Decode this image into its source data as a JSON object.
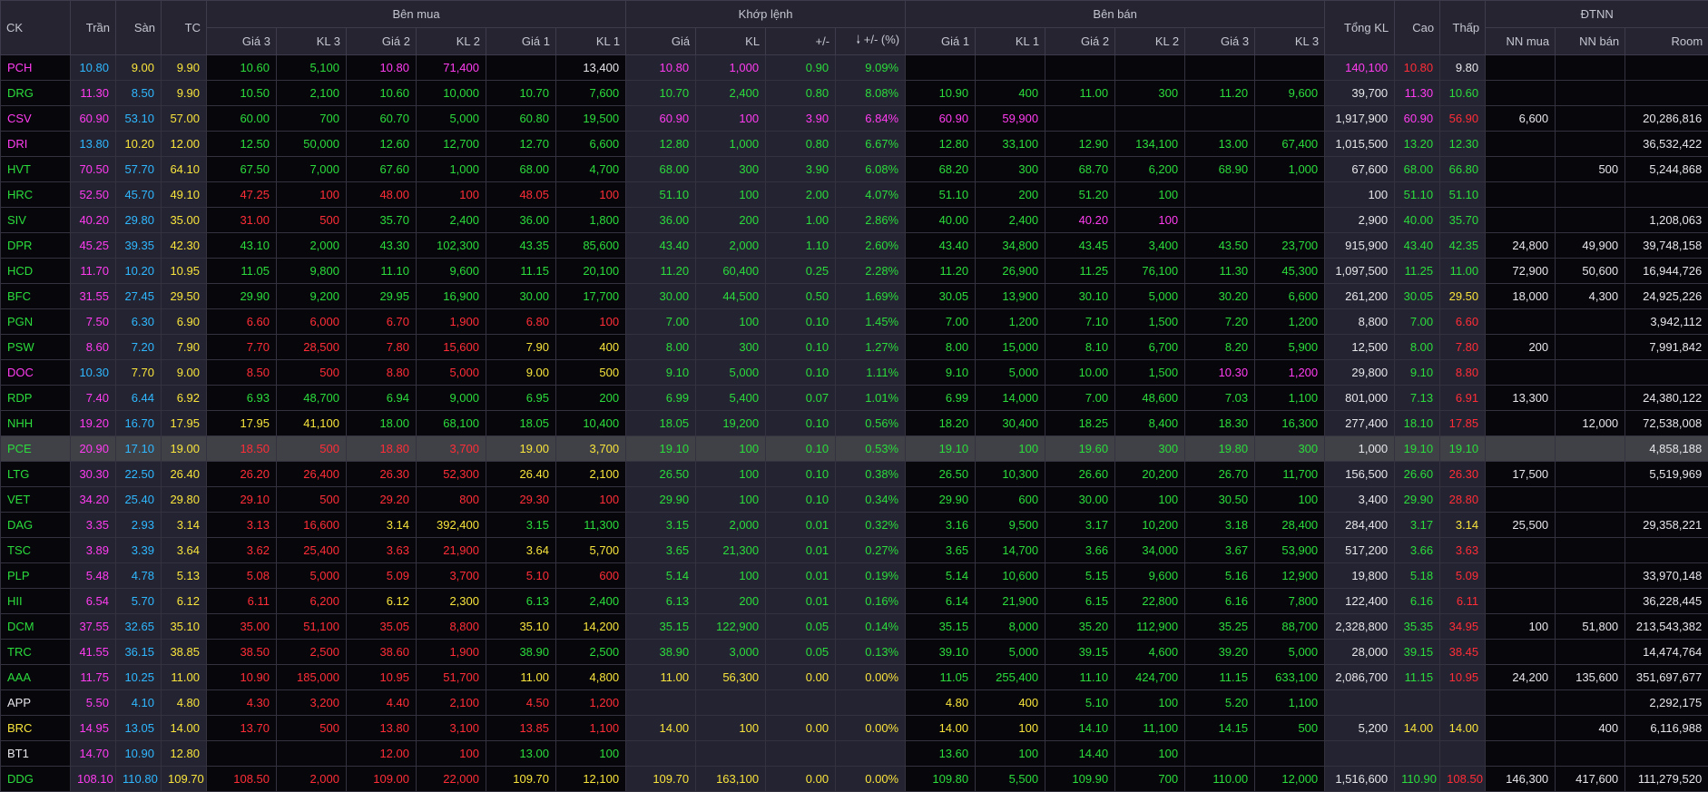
{
  "colors": {
    "up": "#2bdc3c",
    "down": "#ff2d37",
    "ref": "#f8e43c",
    "ceil": "#ff3cf0",
    "floor": "#2fb8ff",
    "white": "#e6e6ea"
  },
  "header": {
    "ck": "CK",
    "tran": "Trần",
    "san": "Sàn",
    "tc": "TC",
    "ben_mua": "Bên mua",
    "khop_lenh": "Khớp lệnh",
    "ben_ban": "Bên bán",
    "tong_kl": "Tổng KL",
    "cao": "Cao",
    "thap": "Thấp",
    "dtnn": "ĐTNN",
    "buy_cols": [
      "Giá 3",
      "KL 3",
      "Giá 2",
      "KL 2",
      "Giá 1",
      "KL 1"
    ],
    "match_cols": [
      "Giá",
      "KL",
      "+/-",
      "+/- (%)"
    ],
    "sell_cols": [
      "Giá 1",
      "KL 1",
      "Giá 2",
      "KL 2",
      "Giá 3",
      "KL 3"
    ],
    "dtnn_cols": [
      "NN mua",
      "NN bán",
      "Room"
    ],
    "sort_icon": "arrow-down-icon"
  },
  "rows": [
    {
      "c": [
        "PCH",
        "10.80",
        "9.00",
        "9.90",
        "10.60",
        "5,100",
        "10.80",
        "71,400",
        "",
        "13,400",
        "10.80",
        "1,000",
        "0.90",
        "9.09%",
        "",
        "",
        "",
        "",
        "",
        "",
        "140,100",
        "10.80",
        "9.80",
        "",
        "",
        ""
      ],
      "k": "cfrr uu cc _w cc uu uu xx uu cd xxx"
    },
    {
      "c": [
        "DRG",
        "11.30",
        "8.50",
        "9.90",
        "10.50",
        "2,100",
        "10.60",
        "10,000",
        "10.70",
        "7,600",
        "10.70",
        "2,400",
        "0.80",
        "8.08%",
        "10.90",
        "400",
        "11.00",
        "300",
        "11.20",
        "9,600",
        "39,700",
        "11.30",
        "10.60",
        "",
        "",
        ""
      ],
      "k": "ucfr uuuuuu uuuu uuuuuu w cu xxx"
    },
    {
      "c": [
        "CSV",
        "60.90",
        "53.10",
        "57.00",
        "60.00",
        "700",
        "60.70",
        "5,000",
        "60.80",
        "19,500",
        "60.90",
        "100",
        "3.90",
        "6.84%",
        "60.90",
        "59,900",
        "",
        "",
        "",
        "",
        "1,917,900",
        "60.90",
        "56.90",
        "6,600",
        "",
        "20,286,816"
      ],
      "k": "ccfr uuuuuu cccc cc____ w cd wxw"
    },
    {
      "c": [
        "DRI",
        "13.80",
        "10.20",
        "12.00",
        "12.50",
        "50,000",
        "12.60",
        "12,700",
        "12.70",
        "6,600",
        "12.80",
        "1,000",
        "0.80",
        "6.67%",
        "12.80",
        "33,100",
        "12.90",
        "134,100",
        "13.00",
        "67,400",
        "1,015,500",
        "13.20",
        "12.30",
        "",
        "",
        "36,532,422"
      ],
      "k": "cfrr uuuuuu uuuu uuuuuu w uu xxw"
    },
    {
      "c": [
        "HVT",
        "70.50",
        "57.70",
        "64.10",
        "67.50",
        "7,000",
        "67.60",
        "1,000",
        "68.00",
        "4,700",
        "68.00",
        "300",
        "3.90",
        "6.08%",
        "68.20",
        "300",
        "68.70",
        "6,200",
        "68.90",
        "1,000",
        "67,600",
        "68.00",
        "66.80",
        "",
        "500",
        "5,244,868"
      ],
      "k": "ucfr uuuuuu uuuu uuuuuu w uu xww"
    },
    {
      "c": [
        "HRC",
        "52.50",
        "45.70",
        "49.10",
        "47.25",
        "100",
        "48.00",
        "100",
        "48.05",
        "100",
        "51.10",
        "100",
        "2.00",
        "4.07%",
        "51.10",
        "200",
        "51.20",
        "100",
        "",
        "",
        "100",
        "51.10",
        "51.10",
        "",
        "",
        ""
      ],
      "k": "ucfr dddddd uuuu uuuu__ w uu xxx"
    },
    {
      "c": [
        "SIV",
        "40.20",
        "29.80",
        "35.00",
        "31.00",
        "500",
        "35.70",
        "2,400",
        "36.00",
        "1,800",
        "36.00",
        "200",
        "1.00",
        "2.86%",
        "40.00",
        "2,400",
        "40.20",
        "100",
        "",
        "",
        "2,900",
        "40.00",
        "35.70",
        "",
        "",
        "1,208,063"
      ],
      "k": "ucfr dduuuu uuuu uucc__ w uu xxw"
    },
    {
      "c": [
        "DPR",
        "45.25",
        "39.35",
        "42.30",
        "43.10",
        "2,000",
        "43.30",
        "102,300",
        "43.35",
        "85,600",
        "43.40",
        "2,000",
        "1.10",
        "2.60%",
        "43.40",
        "34,800",
        "43.45",
        "3,400",
        "43.50",
        "23,700",
        "915,900",
        "43.40",
        "42.35",
        "24,800",
        "49,900",
        "39,748,158"
      ],
      "k": "ucfr uuuuuu uuuu uuuuuu w uu www"
    },
    {
      "c": [
        "HCD",
        "11.70",
        "10.20",
        "10.95",
        "11.05",
        "9,800",
        "11.10",
        "9,600",
        "11.15",
        "20,100",
        "11.20",
        "60,400",
        "0.25",
        "2.28%",
        "11.20",
        "26,900",
        "11.25",
        "76,100",
        "11.30",
        "45,300",
        "1,097,500",
        "11.25",
        "11.00",
        "72,900",
        "50,600",
        "16,944,726"
      ],
      "k": "ucfr uuuuuu uuuu uuuuuu w uu www"
    },
    {
      "c": [
        "BFC",
        "31.55",
        "27.45",
        "29.50",
        "29.90",
        "9,200",
        "29.95",
        "16,900",
        "30.00",
        "17,700",
        "30.00",
        "44,500",
        "0.50",
        "1.69%",
        "30.05",
        "13,900",
        "30.10",
        "5,000",
        "30.20",
        "6,600",
        "261,200",
        "30.05",
        "29.50",
        "18,000",
        "4,300",
        "24,925,226"
      ],
      "k": "ucfr uuuuuu uuuu uuuuuu w ur www"
    },
    {
      "c": [
        "PGN",
        "7.50",
        "6.30",
        "6.90",
        "6.60",
        "6,000",
        "6.70",
        "1,900",
        "6.80",
        "100",
        "7.00",
        "100",
        "0.10",
        "1.45%",
        "7.00",
        "1,200",
        "7.10",
        "1,500",
        "7.20",
        "1,200",
        "8,800",
        "7.00",
        "6.60",
        "",
        "",
        "3,942,112"
      ],
      "k": "ucfr dddddd uuuu uuuuuu w ud xxw"
    },
    {
      "c": [
        "PSW",
        "8.60",
        "7.20",
        "7.90",
        "7.70",
        "28,500",
        "7.80",
        "15,600",
        "7.90",
        "400",
        "8.00",
        "300",
        "0.10",
        "1.27%",
        "8.00",
        "15,000",
        "8.10",
        "6,700",
        "8.20",
        "5,900",
        "12,500",
        "8.00",
        "7.80",
        "200",
        "",
        "7,991,842"
      ],
      "k": "ucfr ddddrr uuuu uuuuuu w ud wxw"
    },
    {
      "c": [
        "DOC",
        "10.30",
        "7.70",
        "9.00",
        "8.50",
        "500",
        "8.80",
        "5,000",
        "9.00",
        "500",
        "9.10",
        "5,000",
        "0.10",
        "1.11%",
        "9.10",
        "5,000",
        "10.00",
        "1,500",
        "10.30",
        "1,200",
        "29,800",
        "9.10",
        "8.80",
        "",
        "",
        ""
      ],
      "k": "cfrr ddddrr uuuu uuuucc w ud xxx"
    },
    {
      "c": [
        "RDP",
        "7.40",
        "6.44",
        "6.92",
        "6.93",
        "48,700",
        "6.94",
        "9,000",
        "6.95",
        "200",
        "6.99",
        "5,400",
        "0.07",
        "1.01%",
        "6.99",
        "14,000",
        "7.00",
        "48,600",
        "7.03",
        "1,100",
        "801,000",
        "7.13",
        "6.91",
        "13,300",
        "",
        "24,380,122"
      ],
      "k": "ucfr uuuuuu uuuu uuuuuu w ud wxw"
    },
    {
      "c": [
        "NHH",
        "19.20",
        "16.70",
        "17.95",
        "17.95",
        "41,100",
        "18.00",
        "68,100",
        "18.05",
        "10,400",
        "18.05",
        "19,200",
        "0.10",
        "0.56%",
        "18.20",
        "30,400",
        "18.25",
        "8,400",
        "18.30",
        "16,300",
        "277,400",
        "18.10",
        "17.85",
        "",
        "12,000",
        "72,538,008"
      ],
      "k": "ucfr rruuuu uuuu uuuuuu w ud xww"
    },
    {
      "c": [
        "PCE",
        "20.90",
        "17.10",
        "19.00",
        "18.50",
        "500",
        "18.80",
        "3,700",
        "19.00",
        "3,700",
        "19.10",
        "100",
        "0.10",
        "0.53%",
        "19.10",
        "100",
        "19.60",
        "300",
        "19.80",
        "300",
        "1,000",
        "19.10",
        "19.10",
        "",
        "",
        "4,858,188"
      ],
      "k": "ucfr ddddrr uuuu uuuuuu w uu xxw",
      "hl": true
    },
    {
      "c": [
        "LTG",
        "30.30",
        "22.50",
        "26.40",
        "26.20",
        "26,400",
        "26.30",
        "52,300",
        "26.40",
        "2,100",
        "26.50",
        "100",
        "0.10",
        "0.38%",
        "26.50",
        "10,300",
        "26.60",
        "20,200",
        "26.70",
        "11,700",
        "156,500",
        "26.60",
        "26.30",
        "17,500",
        "",
        "5,519,969"
      ],
      "k": "ucfr ddddrr uuuu uuuuuu w ud wxw"
    },
    {
      "c": [
        "VET",
        "34.20",
        "25.40",
        "29.80",
        "29.10",
        "500",
        "29.20",
        "800",
        "29.30",
        "100",
        "29.90",
        "100",
        "0.10",
        "0.34%",
        "29.90",
        "600",
        "30.00",
        "100",
        "30.50",
        "100",
        "3,400",
        "29.90",
        "28.80",
        "",
        "",
        ""
      ],
      "k": "ucfr dddddd uuuu uuuuuu w ud xxx"
    },
    {
      "c": [
        "DAG",
        "3.35",
        "2.93",
        "3.14",
        "3.13",
        "16,600",
        "3.14",
        "392,400",
        "3.15",
        "11,300",
        "3.15",
        "2,000",
        "0.01",
        "0.32%",
        "3.16",
        "9,500",
        "3.17",
        "10,200",
        "3.18",
        "28,400",
        "284,400",
        "3.17",
        "3.14",
        "25,500",
        "",
        "29,358,221"
      ],
      "k": "ucfr ddrruu uuuu uuuuuu w ur wxw"
    },
    {
      "c": [
        "TSC",
        "3.89",
        "3.39",
        "3.64",
        "3.62",
        "25,400",
        "3.63",
        "21,900",
        "3.64",
        "5,700",
        "3.65",
        "21,300",
        "0.01",
        "0.27%",
        "3.65",
        "14,700",
        "3.66",
        "34,000",
        "3.67",
        "53,900",
        "517,200",
        "3.66",
        "3.63",
        "",
        "",
        ""
      ],
      "k": "ucfr ddddrr uuuu uuuuuu w ud xxx"
    },
    {
      "c": [
        "PLP",
        "5.48",
        "4.78",
        "5.13",
        "5.08",
        "5,000",
        "5.09",
        "3,700",
        "5.10",
        "600",
        "5.14",
        "100",
        "0.01",
        "0.19%",
        "5.14",
        "10,600",
        "5.15",
        "9,600",
        "5.16",
        "12,900",
        "19,800",
        "5.18",
        "5.09",
        "",
        "",
        "33,970,148"
      ],
      "k": "ucfr dddddd uuuu uuuuuu w ud xxw"
    },
    {
      "c": [
        "HII",
        "6.54",
        "5.70",
        "6.12",
        "6.11",
        "6,200",
        "6.12",
        "2,300",
        "6.13",
        "2,400",
        "6.13",
        "200",
        "0.01",
        "0.16%",
        "6.14",
        "21,900",
        "6.15",
        "22,800",
        "6.16",
        "7,800",
        "122,400",
        "6.16",
        "6.11",
        "",
        "",
        "36,228,445"
      ],
      "k": "ucfr ddrruu uuuu uuuuuu w ud xxw"
    },
    {
      "c": [
        "DCM",
        "37.55",
        "32.65",
        "35.10",
        "35.00",
        "51,100",
        "35.05",
        "8,800",
        "35.10",
        "14,200",
        "35.15",
        "122,900",
        "0.05",
        "0.14%",
        "35.15",
        "8,000",
        "35.20",
        "112,900",
        "35.25",
        "88,700",
        "2,328,800",
        "35.35",
        "34.95",
        "100",
        "51,800",
        "213,543,382"
      ],
      "k": "ucfr ddddrr uuuu uuuuuu w ud www"
    },
    {
      "c": [
        "TRC",
        "41.55",
        "36.15",
        "38.85",
        "38.50",
        "2,500",
        "38.60",
        "1,900",
        "38.90",
        "2,500",
        "38.90",
        "3,000",
        "0.05",
        "0.13%",
        "39.10",
        "5,000",
        "39.15",
        "4,600",
        "39.20",
        "5,000",
        "28,000",
        "39.15",
        "38.45",
        "",
        "",
        "14,474,764"
      ],
      "k": "ucfr dddduu uuuu uuuuuu w ud xxw"
    },
    {
      "c": [
        "AAA",
        "11.75",
        "10.25",
        "11.00",
        "10.90",
        "185,000",
        "10.95",
        "51,700",
        "11.00",
        "4,800",
        "11.00",
        "56,300",
        "0.00",
        "0.00%",
        "11.05",
        "255,400",
        "11.10",
        "424,700",
        "11.15",
        "633,100",
        "2,086,700",
        "11.15",
        "10.95",
        "24,200",
        "135,600",
        "351,697,677"
      ],
      "k": "ucfr ddddrr rrrr uuuuuu w ud www"
    },
    {
      "c": [
        "APP",
        "5.50",
        "4.10",
        "4.80",
        "4.30",
        "3,200",
        "4.40",
        "2,100",
        "4.50",
        "1,200",
        "",
        "",
        "",
        "",
        "4.80",
        "400",
        "5.10",
        "100",
        "5.20",
        "1,100",
        "",
        "",
        "",
        "",
        "",
        "2,292,175"
      ],
      "k": "wcfr dddddd ____ rruuuu x __ xxw"
    },
    {
      "c": [
        "BRC",
        "14.95",
        "13.05",
        "14.00",
        "13.70",
        "500",
        "13.80",
        "3,100",
        "13.85",
        "1,100",
        "14.00",
        "100",
        "0.00",
        "0.00%",
        "14.00",
        "100",
        "14.10",
        "11,100",
        "14.15",
        "500",
        "5,200",
        "14.00",
        "14.00",
        "",
        "400",
        "6,116,988"
      ],
      "k": "rcfr dddddd rrrr rruuuu w rr xww"
    },
    {
      "c": [
        "BT1",
        "14.70",
        "10.90",
        "12.80",
        "",
        "",
        "12.00",
        "100",
        "13.00",
        "100",
        "",
        "",
        "",
        "",
        "13.60",
        "100",
        "14.40",
        "100",
        "",
        "",
        "",
        "",
        "",
        "",
        "",
        ""
      ],
      "k": "wcfr __dduu ____ uuuu__ x __ xxx"
    },
    {
      "c": [
        "DDG",
        "108.10",
        "110.80",
        "109.70",
        "108.50",
        "2,000",
        "109.00",
        "22,000",
        "109.70",
        "12,100",
        "109.70",
        "163,100",
        "0.00",
        "0.00%",
        "109.80",
        "5,500",
        "109.90",
        "700",
        "110.00",
        "12,000",
        "1,516,600",
        "110.90",
        "108.50",
        "146,300",
        "417,600",
        "111,279,520"
      ],
      "k": "ucfr ddddrr rrrr uuuuuu w ud www"
    }
  ]
}
